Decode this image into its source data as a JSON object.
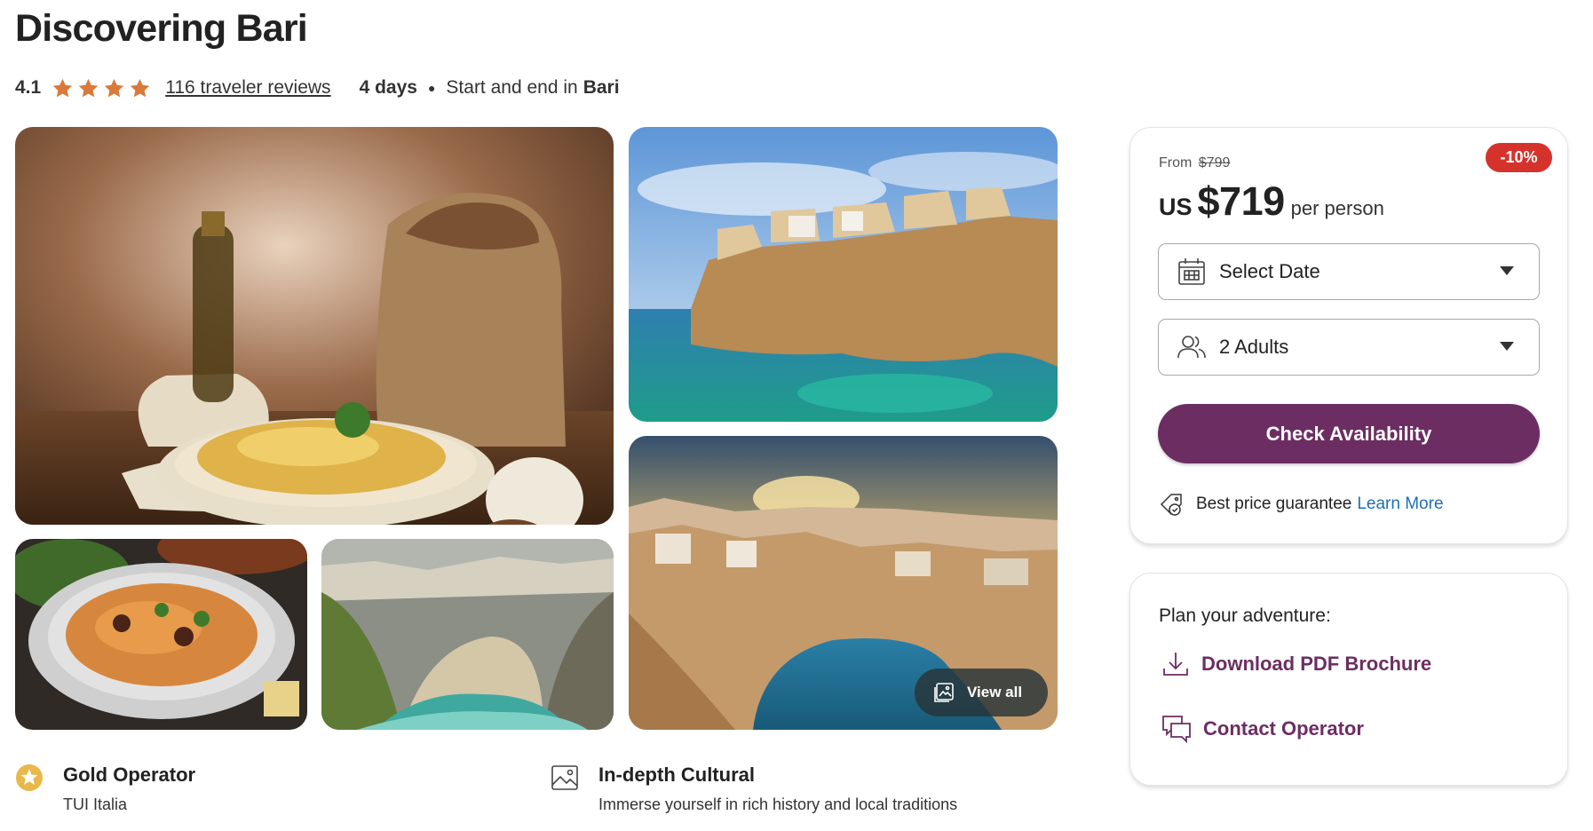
{
  "header": {
    "title": "Discovering Bari",
    "rating": "4.1",
    "stars": 4,
    "reviews_link": "116 traveler reviews",
    "duration": "4 days",
    "start_end_prefix": "Start and end in",
    "start_end_city": "Bari"
  },
  "gallery": {
    "view_all_label": "View all"
  },
  "booking": {
    "discount_badge": "-10%",
    "from_label": "From",
    "original_price": "$799",
    "currency": "US",
    "price": "$719",
    "per_person": "per person",
    "date_select": "Select Date",
    "travelers_select": "2 Adults",
    "check_button": "Check Availability",
    "guarantee_text": "Best price guarantee",
    "learn_more": "Learn More"
  },
  "plan": {
    "title": "Plan your adventure:",
    "download_link": "Download PDF Brochure",
    "contact_link": "Contact Operator"
  },
  "features": [
    {
      "title": "Gold Operator",
      "subtitle": "TUI Italia",
      "icon": "gold-star-badge-icon"
    },
    {
      "title": "In-depth Cultural",
      "subtitle": "Immerse yourself in rich history and local traditions",
      "icon": "image-frame-icon"
    }
  ],
  "colors": {
    "accent": "#6c2e62",
    "star": "#d97a3a",
    "badge": "#d6322c",
    "link": "#1f6fb2"
  }
}
